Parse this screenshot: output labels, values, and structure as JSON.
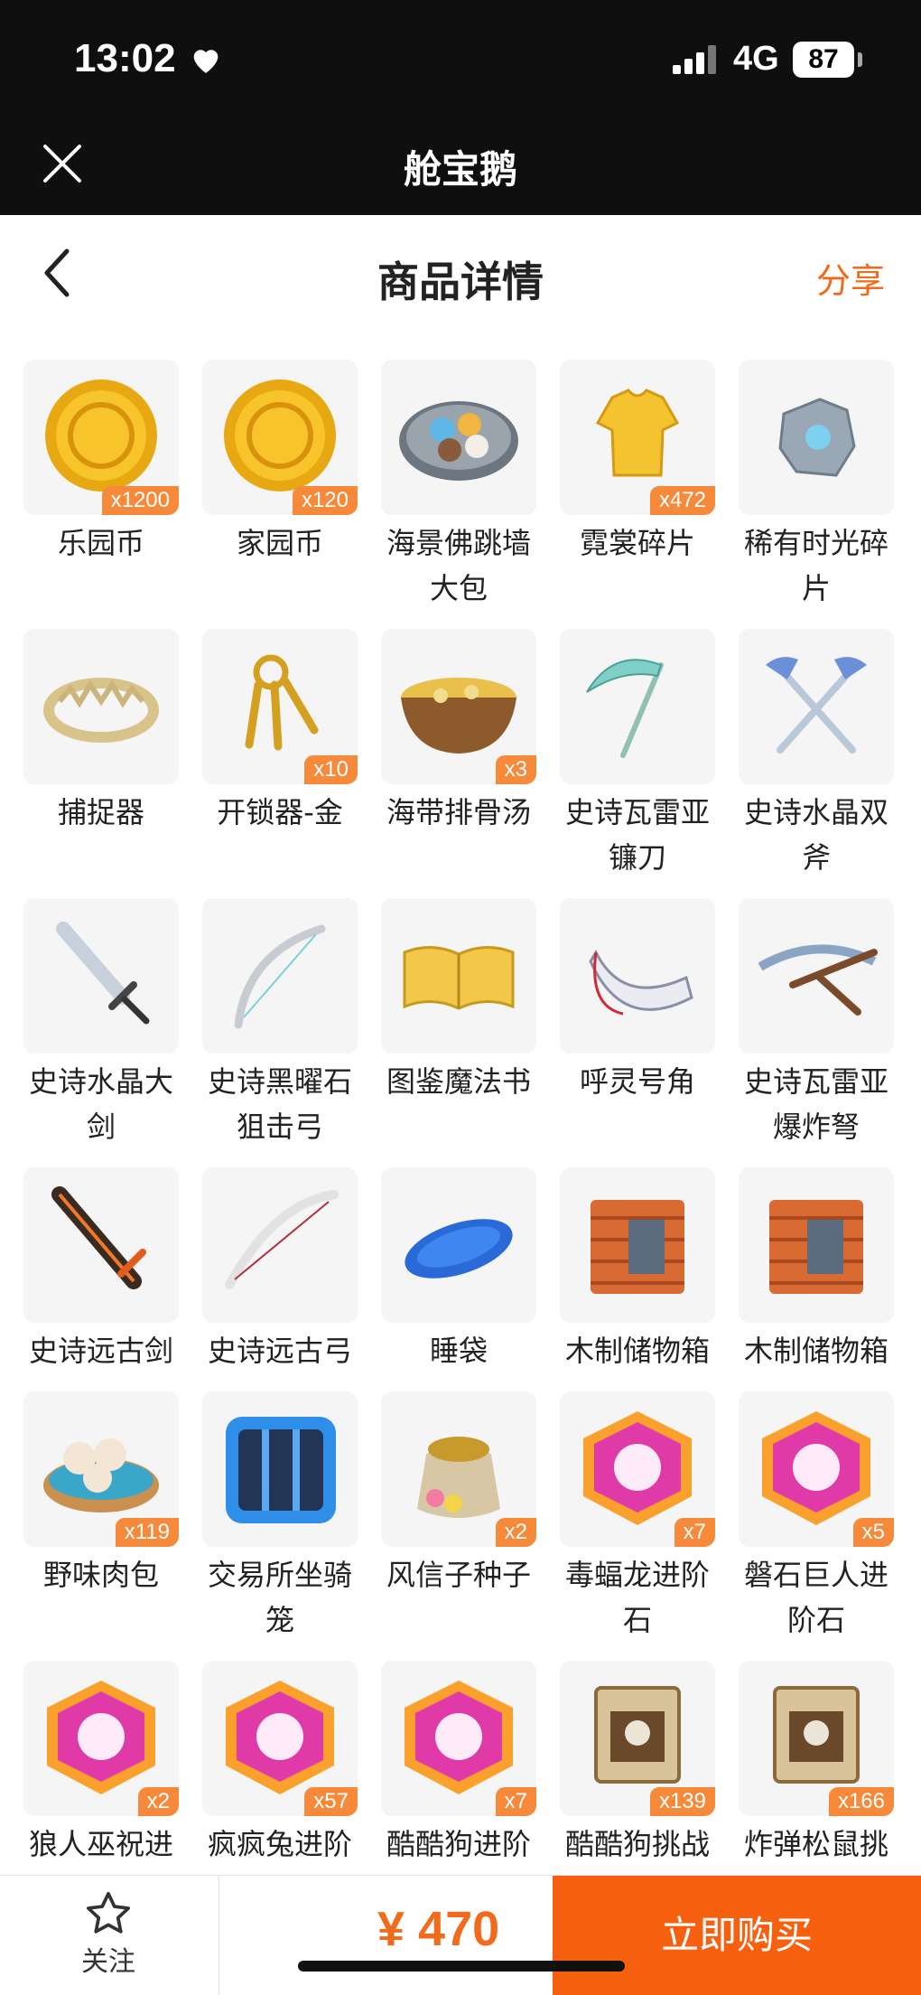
{
  "status": {
    "time": "13:02",
    "network": "4G",
    "battery": "87"
  },
  "app": {
    "title": "舱宝鹅"
  },
  "nav": {
    "title": "商品详情",
    "share": "分享"
  },
  "items": [
    {
      "name": "乐园币",
      "badge": "x1200",
      "icon": "gold-coin-icon"
    },
    {
      "name": "家园币",
      "badge": "x120",
      "icon": "gold-coin-icon"
    },
    {
      "name": "海景佛跳墙大包",
      "badge": "",
      "icon": "dumpling-plate-icon"
    },
    {
      "name": "霓裳碎片",
      "badge": "x472",
      "icon": "shirt-icon"
    },
    {
      "name": "稀有时光碎片",
      "badge": "",
      "icon": "puzzle-fragment-icon"
    },
    {
      "name": "捕捉器",
      "badge": "",
      "icon": "trap-icon"
    },
    {
      "name": "开锁器-金",
      "badge": "x10",
      "icon": "keys-icon"
    },
    {
      "name": "海带排骨汤",
      "badge": "x3",
      "icon": "soup-bowl-icon"
    },
    {
      "name": "史诗瓦雷亚镰刀",
      "badge": "",
      "icon": "scythe-icon"
    },
    {
      "name": "史诗水晶双斧",
      "badge": "",
      "icon": "double-axe-icon"
    },
    {
      "name": "史诗水晶大剑",
      "badge": "",
      "icon": "sword-icon"
    },
    {
      "name": "史诗黑曜石狙击弓",
      "badge": "",
      "icon": "bow-icon"
    },
    {
      "name": "图鉴魔法书",
      "badge": "",
      "icon": "book-icon"
    },
    {
      "name": "呼灵号角",
      "badge": "",
      "icon": "horn-icon"
    },
    {
      "name": "史诗瓦雷亚爆炸弩",
      "badge": "",
      "icon": "crossbow-icon"
    },
    {
      "name": "史诗远古剑",
      "badge": "",
      "icon": "ancient-sword-icon"
    },
    {
      "name": "史诗远古弓",
      "badge": "",
      "icon": "ancient-bow-icon"
    },
    {
      "name": "睡袋",
      "badge": "",
      "icon": "sleeping-bag-icon"
    },
    {
      "name": "木制储物箱",
      "badge": "",
      "icon": "wooden-box-icon"
    },
    {
      "name": "木制储物箱",
      "badge": "",
      "icon": "wooden-box-icon"
    },
    {
      "name": "野味肉包",
      "badge": "x119",
      "icon": "buns-icon"
    },
    {
      "name": "交易所坐骑笼",
      "badge": "",
      "icon": "cage-icon"
    },
    {
      "name": "风信子种子",
      "badge": "x2",
      "icon": "seed-bag-icon"
    },
    {
      "name": "毒蝠龙进阶石",
      "badge": "x7",
      "icon": "gem-stone-icon"
    },
    {
      "name": "磐石巨人进阶石",
      "badge": "x5",
      "icon": "gem-stone-icon"
    },
    {
      "name": "狼人巫祝进阶石",
      "badge": "x2",
      "icon": "gem-stone-icon"
    },
    {
      "name": "疯疯兔进阶石",
      "badge": "x57",
      "icon": "gem-stone-icon"
    },
    {
      "name": "酷酷狗进阶石",
      "badge": "x7",
      "icon": "gem-stone-icon"
    },
    {
      "name": "酷酷狗挑战书",
      "badge": "x139",
      "icon": "wanted-poster-icon"
    },
    {
      "name": "炸弹松鼠挑战书",
      "badge": "x166",
      "icon": "wanted-poster-icon"
    }
  ],
  "bottom": {
    "follow": "关注",
    "price": "¥ 470",
    "buy": "立即购买"
  },
  "colors": {
    "accent": "#f26a1b",
    "buy_button": "#f7600e",
    "badge": "#f7893a"
  }
}
